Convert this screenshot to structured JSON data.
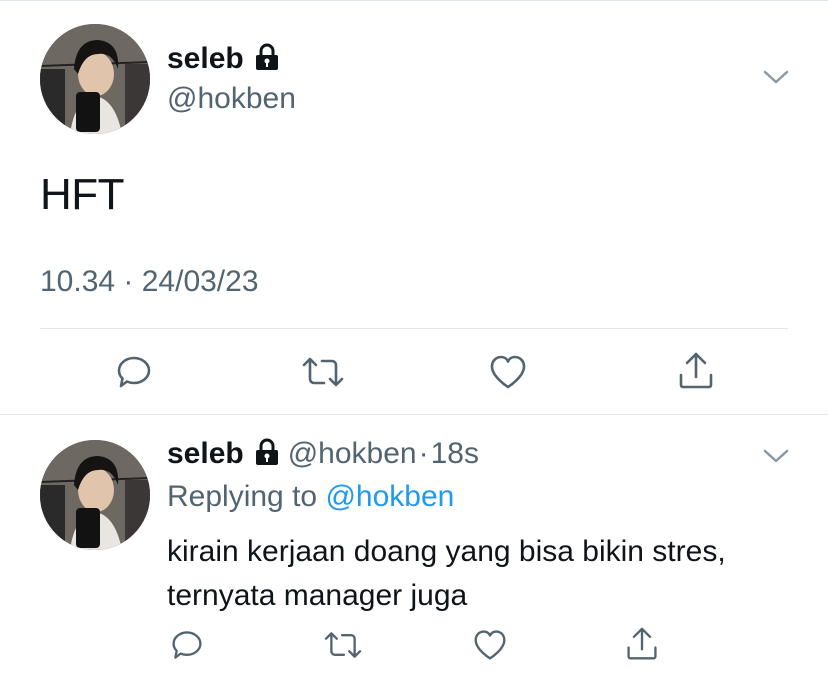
{
  "main_tweet": {
    "display_name": "seleb",
    "handle": "@hokben",
    "text": "HFT",
    "timestamp": "10.34 · 24/03/23",
    "protected_icon": "lock-icon",
    "menu_icon": "chevron-down-icon"
  },
  "reply": {
    "display_name": "seleb",
    "handle": "@hokben",
    "dot": "·",
    "time": "18s",
    "replying_prefix": "Replying to",
    "replying_mention": "@hokben",
    "text_line1": "kirain kerjaan doang yang bisa bikin stres,",
    "text_line2": "ternyata manager juga"
  },
  "actions": [
    "reply-icon",
    "retweet-icon",
    "like-icon",
    "share-icon"
  ],
  "colors": {
    "text": "#0f1419",
    "secondary": "#536471",
    "link": "#1d9bf0",
    "border": "#e1e8ed"
  }
}
